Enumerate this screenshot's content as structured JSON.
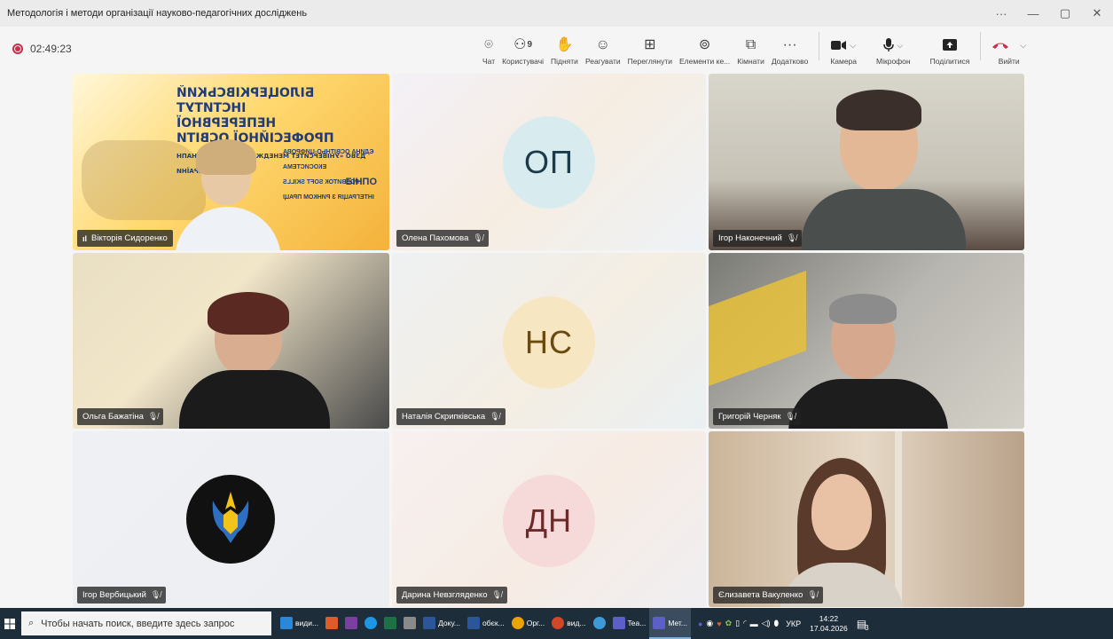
{
  "window": {
    "title": "Методологія і методи організації науково-педагогічних досліджень",
    "controls": {
      "more": "···",
      "minimize": "—",
      "restore": "▢",
      "close": "✕"
    }
  },
  "toolbar": {
    "timer": "02:49:23",
    "items": [
      {
        "label": "Чат",
        "icon": "chat-icon",
        "glyph": "⌾"
      },
      {
        "label": "Користувачі",
        "icon": "people-icon",
        "glyph": "⚇",
        "count": "9"
      },
      {
        "label": "Підняти",
        "icon": "raise-hand-icon",
        "glyph": "✋"
      },
      {
        "label": "Реагувати",
        "icon": "react-icon",
        "glyph": "☺"
      },
      {
        "label": "Переглянути",
        "icon": "view-icon",
        "glyph": "⊞"
      },
      {
        "label": "Елементи ке...",
        "icon": "apps-icon",
        "glyph": "⊚"
      },
      {
        "label": "Кімнати",
        "icon": "rooms-icon",
        "glyph": "⧉"
      },
      {
        "label": "Додатково",
        "icon": "more-icon",
        "glyph": "···"
      }
    ],
    "camera": "Камера",
    "mic": "Мікрофон",
    "share": "Поділитися",
    "leave": "Вийти"
  },
  "participants": [
    {
      "name": "Вікторія Сидоренко",
      "speaking": true,
      "muted": false
    },
    {
      "name": "Олена Пахомова",
      "initials": "ОП",
      "muted": true,
      "color": "#d8ecef",
      "text_color": "#1c3b4a"
    },
    {
      "name": "Ігор Наконечний",
      "muted": true
    },
    {
      "name": "Ольга Бажатіна",
      "muted": true
    },
    {
      "name": "Наталія Скрипківська",
      "initials": "НС",
      "muted": true,
      "color": "#f7e6c2",
      "text_color": "#6b4a0e"
    },
    {
      "name": "Григорій Черняк",
      "muted": true
    },
    {
      "name": "Ігор Вербицький",
      "muted": true
    },
    {
      "name": "Дарина Невзгляденко",
      "initials": "ДН",
      "muted": true,
      "color": "#f6d9d9",
      "text_color": "#6e2a2a"
    },
    {
      "name": "Єлизавета Вакуленко",
      "muted": true
    }
  ],
  "banner": {
    "line1": "БІЛОЦЕРКІВСЬКИЙ ІНСТИТУТ",
    "line2": "НЕПЕРЕРВНОЇ ПРОФЕСІЙНОЇ ОСВІТИ",
    "line3": "ДЗВО «УНІВЕРСИТЕТ МЕНЕДЖМЕНТУ ОСВІТИ» НАПН УКРАЇНИ",
    "logo": "БІНПО",
    "list": [
      "ЄДИНА ОСВІТНЬО-ЦИФРОВА ЕКОСИСТЕМА",
      "РОЗВИТОК SOFT SKILLS",
      "ІНТЕГРАЦІЯ З РИНКОМ ПРАЦІ"
    ]
  },
  "taskbar": {
    "search_placeholder": "Чтобы начать поиск, введите здесь запрос",
    "apps": [
      {
        "label": "види...",
        "color": "#2b88d8"
      },
      {
        "label": "",
        "color": "#e05b2c"
      },
      {
        "label": "",
        "color": "#7b3fa0"
      },
      {
        "label": "",
        "color": "#1d96e6"
      },
      {
        "label": "",
        "color": "#1e7145"
      },
      {
        "label": "",
        "color": "#8a8a8a"
      },
      {
        "label": "Доку...",
        "color": "#2b579a"
      },
      {
        "label": "обєк...",
        "color": "#2b579a"
      },
      {
        "label": "Орг...",
        "color": "#e8a400"
      },
      {
        "label": "вид...",
        "color": "#d24726"
      },
      {
        "label": "",
        "color": "#3c9bd6"
      },
      {
        "label": "Tea...",
        "color": "#5b5fc7"
      },
      {
        "label": "Мет...",
        "color": "#5b5fc7",
        "active": true
      }
    ],
    "lang": "УКР",
    "time": "14:22",
    "date": "17.04.2026",
    "notifications": "3"
  }
}
